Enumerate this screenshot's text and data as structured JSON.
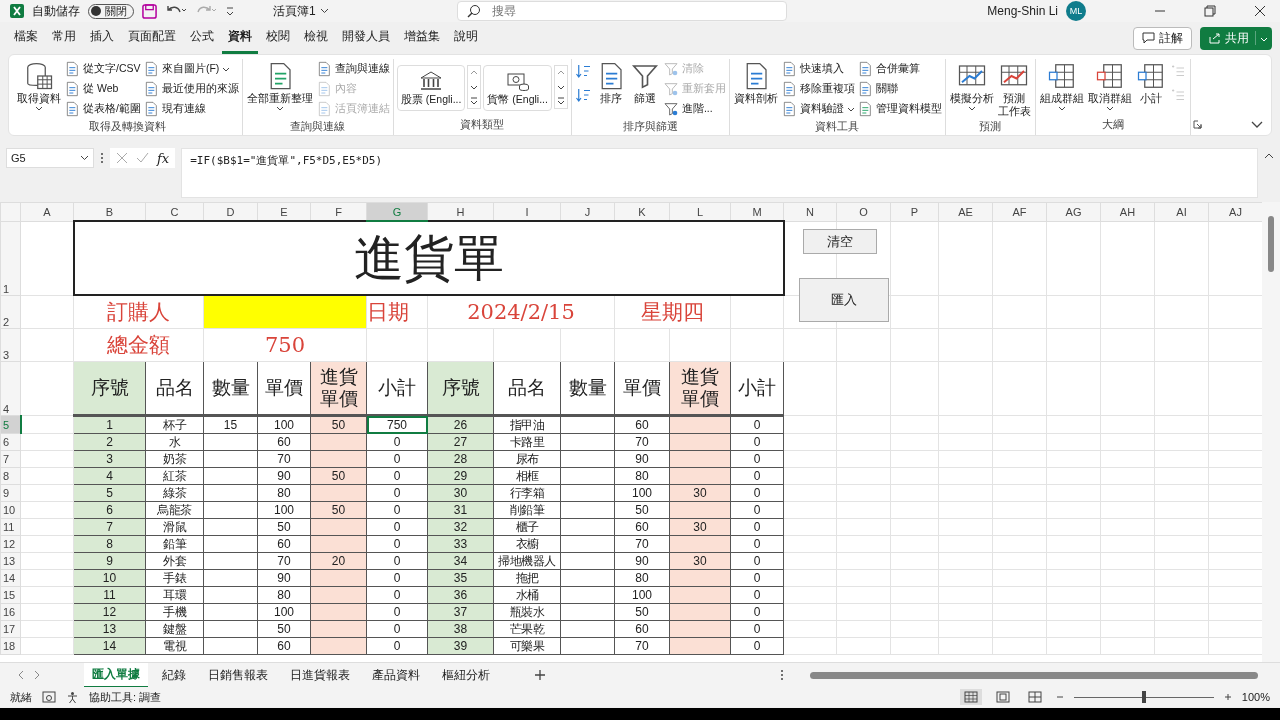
{
  "title_bar": {
    "autosave_label": "自動儲存",
    "autosave": {
      "on": false,
      "label": "關閉"
    },
    "title": "活頁簿1",
    "search": {
      "placeholder": "搜尋"
    },
    "user": "Meng-Shin Li",
    "avatar": "ML"
  },
  "ribbon_tabs": [
    {
      "label": "檔案",
      "selected": false
    },
    {
      "label": "常用",
      "selected": false
    },
    {
      "label": "插入",
      "selected": false
    },
    {
      "label": "頁面配置",
      "selected": false
    },
    {
      "label": "公式",
      "selected": false
    },
    {
      "label": "資料",
      "selected": true
    },
    {
      "label": "校閱",
      "selected": false
    },
    {
      "label": "檢視",
      "selected": false
    },
    {
      "label": "開發人員",
      "selected": false
    },
    {
      "label": "增益集",
      "selected": false
    },
    {
      "label": "說明",
      "selected": false
    }
  ],
  "comments_button": "註解",
  "share_button": "共用",
  "ribbon_groups": [
    {
      "label": "取得及轉換資料",
      "items": [
        {
          "kind": "large",
          "label": "取得資料",
          "disabled": false,
          "dropdown": true
        },
        {
          "kind": "small",
          "label": "從文字/CSV",
          "disabled": false,
          "dropdown": false
        },
        {
          "kind": "small",
          "label": "從 Web",
          "disabled": false,
          "dropdown": false
        },
        {
          "kind": "small",
          "label": "從表格/範圍",
          "disabled": false,
          "dropdown": false
        },
        {
          "kind": "small",
          "label": "來自圖片(F)",
          "disabled": false,
          "dropdown": true
        },
        {
          "kind": "small",
          "label": "最近使用的來源",
          "disabled": false,
          "dropdown": false
        },
        {
          "kind": "small",
          "label": "現有連線",
          "disabled": false,
          "dropdown": false
        }
      ]
    },
    {
      "label": "查詢與連線",
      "items": [
        {
          "kind": "large",
          "label": "全部重新整理",
          "disabled": false,
          "dropdown": true
        },
        {
          "kind": "small",
          "label": "查詢與連線",
          "disabled": false,
          "dropdown": false
        },
        {
          "kind": "small",
          "label": "內容",
          "disabled": true,
          "dropdown": false
        },
        {
          "kind": "small",
          "label": "活頁簿連結",
          "disabled": true,
          "dropdown": false
        }
      ]
    },
    {
      "label": "資料類型",
      "items": [
        {
          "kind": "gallery",
          "label": "股票 (Engli...",
          "disabled": false,
          "dropdown": false
        },
        {
          "kind": "gallery",
          "label": "貨幣 (Engli...",
          "disabled": false,
          "dropdown": false
        }
      ]
    },
    {
      "label": "排序與篩選",
      "items": [
        {
          "kind": "icon",
          "disabled": false,
          "dropdown": false
        },
        {
          "kind": "icon",
          "disabled": false,
          "dropdown": false
        },
        {
          "kind": "large",
          "label": "排序",
          "disabled": false,
          "dropdown": false
        },
        {
          "kind": "large",
          "label": "篩選",
          "disabled": false,
          "dropdown": false
        },
        {
          "kind": "small",
          "label": "清除",
          "disabled": true,
          "dropdown": false
        },
        {
          "kind": "small",
          "label": "重新套用",
          "disabled": true,
          "dropdown": false
        },
        {
          "kind": "small",
          "label": "進階...",
          "disabled": false,
          "dropdown": false
        }
      ]
    },
    {
      "label": "資料工具",
      "items": [
        {
          "kind": "large",
          "label": "資料剖析",
          "disabled": false,
          "dropdown": false
        },
        {
          "kind": "small",
          "label": "快速填入",
          "disabled": false,
          "dropdown": false
        },
        {
          "kind": "small",
          "label": "移除重複項",
          "disabled": false,
          "dropdown": false
        },
        {
          "kind": "small",
          "label": "資料驗證",
          "disabled": false,
          "dropdown": true
        },
        {
          "kind": "small",
          "label": "合併彙算",
          "disabled": false,
          "dropdown": false
        },
        {
          "kind": "small",
          "label": "關聯",
          "disabled": false,
          "dropdown": false
        },
        {
          "kind": "small",
          "label": "管理資料模型",
          "disabled": false,
          "dropdown": false
        }
      ]
    },
    {
      "label": "預測",
      "items": [
        {
          "kind": "large",
          "label": "模擬分析",
          "disabled": false,
          "dropdown": true
        },
        {
          "kind": "large",
          "label": "預測",
          "sublabel": "工作表",
          "disabled": false,
          "dropdown": false
        }
      ]
    },
    {
      "label": "大綱",
      "items": [
        {
          "kind": "large",
          "label": "組成群組",
          "disabled": false,
          "dropdown": true
        },
        {
          "kind": "large",
          "label": "取消群組",
          "disabled": false,
          "dropdown": true
        },
        {
          "kind": "large",
          "label": "小計",
          "disabled": false,
          "dropdown": false
        },
        {
          "kind": "icon",
          "disabled": true,
          "dropdown": false
        },
        {
          "kind": "icon",
          "disabled": true,
          "dropdown": false
        }
      ]
    }
  ],
  "formula_bar": {
    "name_box": "G5",
    "function_button": "fx",
    "formula": "=IF($B$1=\"進貨單\",F5*D5,E5*D5)"
  },
  "columns": [
    {
      "label": "A",
      "selected": false
    },
    {
      "label": "B",
      "selected": false
    },
    {
      "label": "C",
      "selected": false
    },
    {
      "label": "D",
      "selected": false
    },
    {
      "label": "E",
      "selected": false
    },
    {
      "label": "F",
      "selected": false
    },
    {
      "label": "G",
      "selected": true
    },
    {
      "label": "H",
      "selected": false
    },
    {
      "label": "I",
      "selected": false
    },
    {
      "label": "J",
      "selected": false
    },
    {
      "label": "K",
      "selected": false
    },
    {
      "label": "L",
      "selected": false
    },
    {
      "label": "M",
      "selected": false
    },
    {
      "label": "N",
      "selected": false
    },
    {
      "label": "O",
      "selected": false
    },
    {
      "label": "P",
      "selected": false
    },
    {
      "label": "AE",
      "selected": false
    },
    {
      "label": "AF",
      "selected": false
    },
    {
      "label": "AG",
      "selected": false
    },
    {
      "label": "AH",
      "selected": false
    },
    {
      "label": "AI",
      "selected": false
    },
    {
      "label": "AJ",
      "selected": false
    }
  ],
  "sheet": {
    "title": "進貨單",
    "orderer_label": "訂購人",
    "date_label": "日期",
    "date": "2024/2/15",
    "weekday": "星期四",
    "total_label": "總金額",
    "total": "750",
    "header_rows": [
      "1",
      "2",
      "3",
      "4"
    ],
    "headers": {
      "left": [
        "序號",
        "品名",
        "數量",
        "單價",
        "進貨單價",
        "小計"
      ],
      "right": [
        "序號",
        "品名",
        "數量",
        "單價",
        "進貨單價",
        "小計"
      ]
    },
    "buttons": [
      "清空",
      "匯入"
    ],
    "rows": [
      {
        "row": "5",
        "selected": true,
        "left": {
          "no": "1",
          "name": "杯子",
          "qty": "15",
          "price": "100",
          "cost": "50",
          "subtotal": "750"
        },
        "right": {
          "no": "26",
          "name": "指甲油",
          "price": "60",
          "subtotal": "0"
        }
      },
      {
        "row": "6",
        "selected": false,
        "left": {
          "no": "2",
          "name": "水",
          "price": "60",
          "subtotal": "0"
        },
        "right": {
          "no": "27",
          "name": "卡路里",
          "price": "70",
          "subtotal": "0"
        }
      },
      {
        "row": "7",
        "selected": false,
        "left": {
          "no": "3",
          "name": "奶茶",
          "price": "70",
          "subtotal": "0"
        },
        "right": {
          "no": "28",
          "name": "尿布",
          "price": "90",
          "subtotal": "0"
        }
      },
      {
        "row": "8",
        "selected": false,
        "left": {
          "no": "4",
          "name": "紅茶",
          "price": "90",
          "cost": "50",
          "subtotal": "0"
        },
        "right": {
          "no": "29",
          "name": "相框",
          "price": "80",
          "subtotal": "0"
        }
      },
      {
        "row": "9",
        "selected": false,
        "left": {
          "no": "5",
          "name": "綠茶",
          "price": "80",
          "subtotal": "0"
        },
        "right": {
          "no": "30",
          "name": "行李箱",
          "price": "100",
          "cost": "30",
          "subtotal": "0"
        }
      },
      {
        "row": "10",
        "selected": false,
        "left": {
          "no": "6",
          "name": "烏龍茶",
          "price": "100",
          "cost": "50",
          "subtotal": "0"
        },
        "right": {
          "no": "31",
          "name": "削鉛筆",
          "price": "50",
          "subtotal": "0"
        }
      },
      {
        "row": "11",
        "selected": false,
        "left": {
          "no": "7",
          "name": "滑鼠",
          "price": "50",
          "subtotal": "0"
        },
        "right": {
          "no": "32",
          "name": "櫃子",
          "price": "60",
          "cost": "30",
          "subtotal": "0"
        }
      },
      {
        "row": "12",
        "selected": false,
        "left": {
          "no": "8",
          "name": "鉛筆",
          "price": "60",
          "subtotal": "0"
        },
        "right": {
          "no": "33",
          "name": "衣櫥",
          "price": "70",
          "subtotal": "0"
        }
      },
      {
        "row": "13",
        "selected": false,
        "left": {
          "no": "9",
          "name": "外套",
          "price": "70",
          "cost": "20",
          "subtotal": "0"
        },
        "right": {
          "no": "34",
          "name": "掃地機器人",
          "price": "90",
          "cost": "30",
          "subtotal": "0"
        }
      },
      {
        "row": "14",
        "selected": false,
        "left": {
          "no": "10",
          "name": "手錶",
          "price": "90",
          "subtotal": "0"
        },
        "right": {
          "no": "35",
          "name": "拖把",
          "price": "80",
          "subtotal": "0"
        }
      },
      {
        "row": "15",
        "selected": false,
        "left": {
          "no": "11",
          "name": "耳環",
          "price": "80",
          "subtotal": "0"
        },
        "right": {
          "no": "36",
          "name": "水桶",
          "price": "100",
          "subtotal": "0"
        }
      },
      {
        "row": "16",
        "selected": false,
        "left": {
          "no": "12",
          "name": "手機",
          "price": "100",
          "subtotal": "0"
        },
        "right": {
          "no": "37",
          "name": "瓶裝水",
          "price": "50",
          "subtotal": "0"
        }
      },
      {
        "row": "17",
        "selected": false,
        "left": {
          "no": "13",
          "name": "鍵盤",
          "price": "50",
          "subtotal": "0"
        },
        "right": {
          "no": "38",
          "name": "芒果乾",
          "price": "60",
          "subtotal": "0"
        }
      },
      {
        "row": "18",
        "selected": false,
        "left": {
          "no": "14",
          "name": "電視",
          "price": "60",
          "subtotal": "0"
        },
        "right": {
          "no": "39",
          "name": "可樂果",
          "price": "70",
          "subtotal": "0"
        }
      }
    ]
  },
  "sheet_tabs": [
    {
      "label": "匯入單據",
      "selected": true
    },
    {
      "label": "紀錄",
      "selected": false
    },
    {
      "label": "日銷售報表",
      "selected": false
    },
    {
      "label": "日進貨報表",
      "selected": false
    },
    {
      "label": "產品資料",
      "selected": false
    },
    {
      "label": "樞紐分析",
      "selected": false
    }
  ],
  "status_bar": {
    "status": "就緒",
    "accessibility": "協助工具: 調查",
    "views": [
      {
        "selected": true
      },
      {
        "selected": false
      },
      {
        "selected": false
      }
    ],
    "zoom": {
      "level": 0.5,
      "label": "100%"
    }
  }
}
